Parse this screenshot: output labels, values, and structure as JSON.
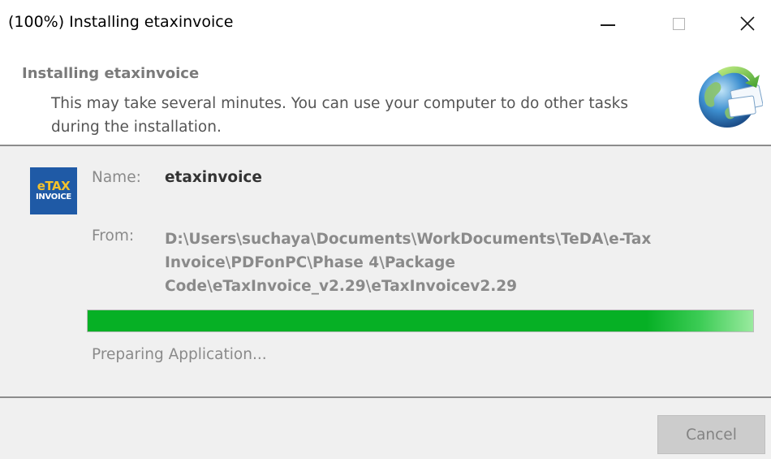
{
  "window": {
    "title": "(100%) Installing etaxinvoice"
  },
  "header": {
    "title": "Installing etaxinvoice",
    "description": "This may take several minutes. You can use your computer to do other tasks during the installation.",
    "icon": "globe-install-icon"
  },
  "app": {
    "icon_line1": "eTAX",
    "icon_line2": "INVOICE",
    "name_label": "Name:",
    "name_value": "etaxinvoice",
    "from_label": "From:",
    "from_value": "D:\\Users\\suchaya\\Documents\\WorkDocuments\\TeDA\\e-Tax Invoice\\PDFonPC\\Phase 4\\Package Code\\eTaxInvoice_v2.29\\eTaxInvoicev2.29"
  },
  "progress": {
    "percent": 100,
    "status": "Preparing Application..."
  },
  "footer": {
    "cancel_label": "Cancel"
  },
  "colors": {
    "progress_green": "#06b025",
    "app_icon_blue": "#1f5aa6"
  }
}
